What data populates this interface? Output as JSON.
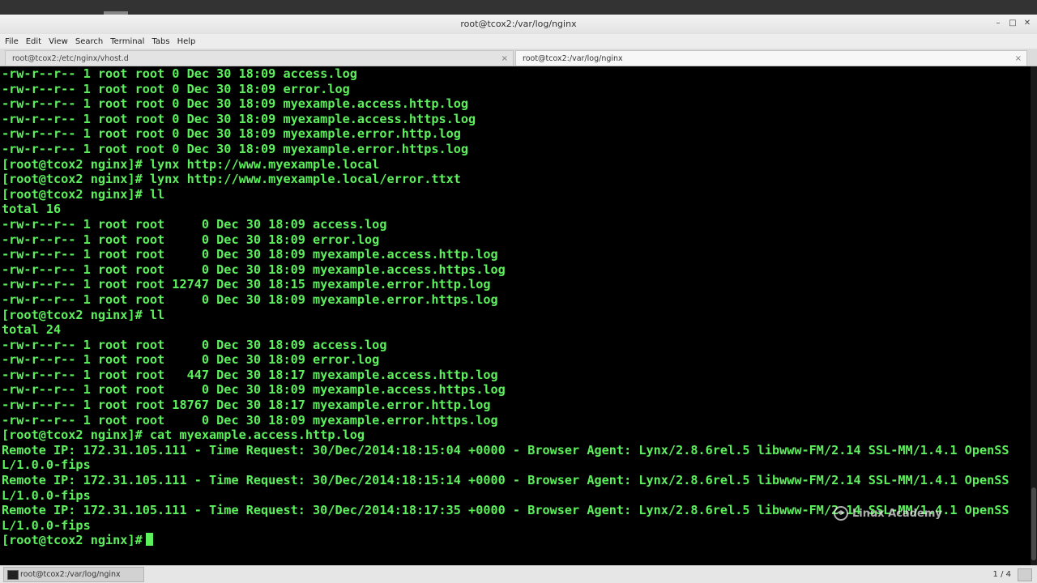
{
  "window": {
    "title": "root@tcox2:/var/log/nginx",
    "minimize": "–",
    "maximize": "□",
    "close": "✕"
  },
  "menu": [
    "File",
    "Edit",
    "View",
    "Search",
    "Terminal",
    "Tabs",
    "Help"
  ],
  "tabs": [
    {
      "label": "root@tcox2:/etc/nginx/vhost.d",
      "close": "×"
    },
    {
      "label": "root@tcox2:/var/log/nginx",
      "close": "×"
    }
  ],
  "terminal": {
    "lines": [
      "-rw-r--r-- 1 root root 0 Dec 30 18:09 access.log",
      "-rw-r--r-- 1 root root 0 Dec 30 18:09 error.log",
      "-rw-r--r-- 1 root root 0 Dec 30 18:09 myexample.access.http.log",
      "-rw-r--r-- 1 root root 0 Dec 30 18:09 myexample.access.https.log",
      "-rw-r--r-- 1 root root 0 Dec 30 18:09 myexample.error.http.log",
      "-rw-r--r-- 1 root root 0 Dec 30 18:09 myexample.error.https.log",
      "[root@tcox2 nginx]# lynx http://www.myexample.local",
      "[root@tcox2 nginx]# lynx http://www.myexample.local/error.ttxt",
      "[root@tcox2 nginx]# ll",
      "total 16",
      "-rw-r--r-- 1 root root     0 Dec 30 18:09 access.log",
      "-rw-r--r-- 1 root root     0 Dec 30 18:09 error.log",
      "-rw-r--r-- 1 root root     0 Dec 30 18:09 myexample.access.http.log",
      "-rw-r--r-- 1 root root     0 Dec 30 18:09 myexample.access.https.log",
      "-rw-r--r-- 1 root root 12747 Dec 30 18:15 myexample.error.http.log",
      "-rw-r--r-- 1 root root     0 Dec 30 18:09 myexample.error.https.log",
      "[root@tcox2 nginx]# ll",
      "total 24",
      "-rw-r--r-- 1 root root     0 Dec 30 18:09 access.log",
      "-rw-r--r-- 1 root root     0 Dec 30 18:09 error.log",
      "-rw-r--r-- 1 root root   447 Dec 30 18:17 myexample.access.http.log",
      "-rw-r--r-- 1 root root     0 Dec 30 18:09 myexample.access.https.log",
      "-rw-r--r-- 1 root root 18767 Dec 30 18:17 myexample.error.http.log",
      "-rw-r--r-- 1 root root     0 Dec 30 18:09 myexample.error.https.log",
      "[root@tcox2 nginx]# cat myexample.access.http.log",
      "Remote IP: 172.31.105.111 - Time Request: 30/Dec/2014:18:15:04 +0000 - Browser Agent: Lynx/2.8.6rel.5 libwww-FM/2.14 SSL-MM/1.4.1 OpenSS",
      "L/1.0.0-fips",
      "Remote IP: 172.31.105.111 - Time Request: 30/Dec/2014:18:15:14 +0000 - Browser Agent: Lynx/2.8.6rel.5 libwww-FM/2.14 SSL-MM/1.4.1 OpenSS",
      "L/1.0.0-fips",
      "Remote IP: 172.31.105.111 - Time Request: 30/Dec/2014:18:17:35 +0000 - Browser Agent: Lynx/2.8.6rel.5 libwww-FM/2.14 SSL-MM/1.4.1 OpenSS",
      "L/1.0.0-fips"
    ],
    "prompt": "[root@tcox2 nginx]# ",
    "text_color": "#5df05d",
    "background": "#000000"
  },
  "watermark": {
    "text": "Linux Academy",
    "icon": "linux-academy-logo-icon"
  },
  "taskbar": {
    "task_label": "root@tcox2:/var/log/nginx",
    "workspace": "1 / 4"
  }
}
